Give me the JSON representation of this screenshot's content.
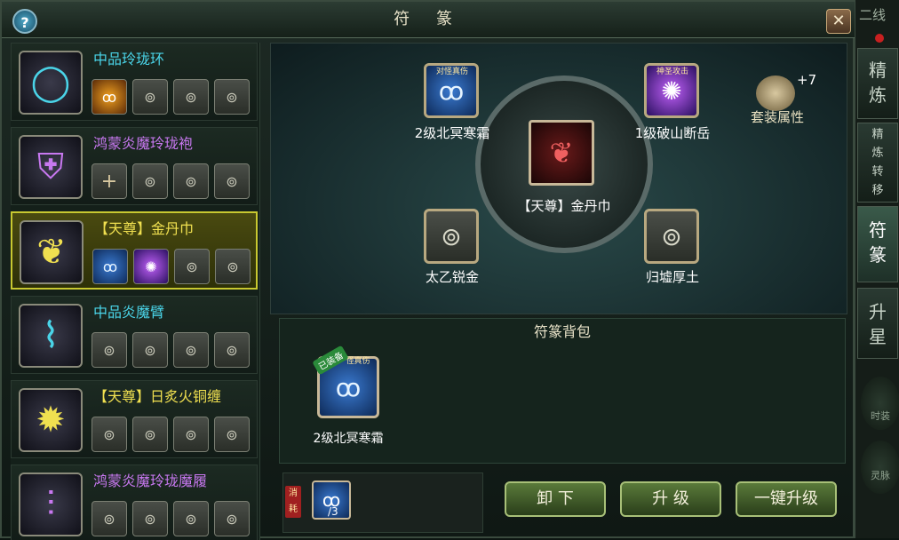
{
  "window": {
    "title": "符 篆",
    "help_label": "?",
    "close_label": "✕"
  },
  "equipment_list": [
    {
      "name": "中品玲珑环",
      "color": "#4ad4e8",
      "thumb_icon": "ring-icon",
      "slots": [
        "rune-orange",
        "empty",
        "empty",
        "empty"
      ]
    },
    {
      "name": "鸿蒙炎魔玲珑袍",
      "color": "#c878f0",
      "thumb_icon": "armor-icon",
      "slots": [
        "plus",
        "empty",
        "empty",
        "empty"
      ]
    },
    {
      "name": "【天尊】金丹巾",
      "color": "#f0e050",
      "thumb_icon": "scarf-icon",
      "slots": [
        "rune-blue",
        "rune-purple",
        "empty",
        "empty"
      ],
      "selected": true
    },
    {
      "name": "中品炎魔臂",
      "color": "#4ad4e8",
      "thumb_icon": "bracer-icon",
      "slots": [
        "empty",
        "empty",
        "empty",
        "empty"
      ]
    },
    {
      "name": "【天尊】日炙火铜缠",
      "color": "#f0e050",
      "thumb_icon": "belt-icon",
      "slots": [
        "empty",
        "empty",
        "empty",
        "empty"
      ]
    },
    {
      "name": "鸿蒙炎魔玲珑魔履",
      "color": "#c878f0",
      "thumb_icon": "boots-icon",
      "slots": [
        "empty",
        "empty",
        "empty",
        "empty"
      ]
    }
  ],
  "rune_board": {
    "center": {
      "label": "【天尊】金丹巾",
      "icon": "scarf-icon"
    },
    "top_left": {
      "label": "2级北冥寒霜",
      "badge": "对怪真伤",
      "icon": "blue-rune-icon"
    },
    "top_right": {
      "label": "1级破山断岳",
      "badge": "神圣攻击",
      "icon": "purple-rune-icon"
    },
    "bottom_left": {
      "label": "太乙锐金",
      "icon": "lock-icon"
    },
    "bottom_right": {
      "label": "归墟厚土",
      "icon": "lock-icon"
    },
    "suit": {
      "label": "套装属性",
      "bonus": "+7"
    }
  },
  "bag": {
    "header": "符篆背包",
    "items": [
      {
        "label": "2级北冥寒霜",
        "badge": "已装备",
        "top_badge": "怪真伤",
        "icon": "blue-rune-icon"
      }
    ]
  },
  "consume": {
    "tag": "消耗",
    "count": "/3"
  },
  "buttons": {
    "unload": "卸 下",
    "upgrade": "升 级",
    "one_key": "一键升级"
  },
  "right_rail": {
    "top_text": "二线",
    "tabs": [
      {
        "label": "精\n炼",
        "active": false
      },
      {
        "label": "精\n炼\n转\n移",
        "active": false
      },
      {
        "label": "符\n篆",
        "active": true
      },
      {
        "label": "升\n星",
        "active": false
      }
    ],
    "bottom_items": [
      "时装",
      "灵脉"
    ]
  }
}
